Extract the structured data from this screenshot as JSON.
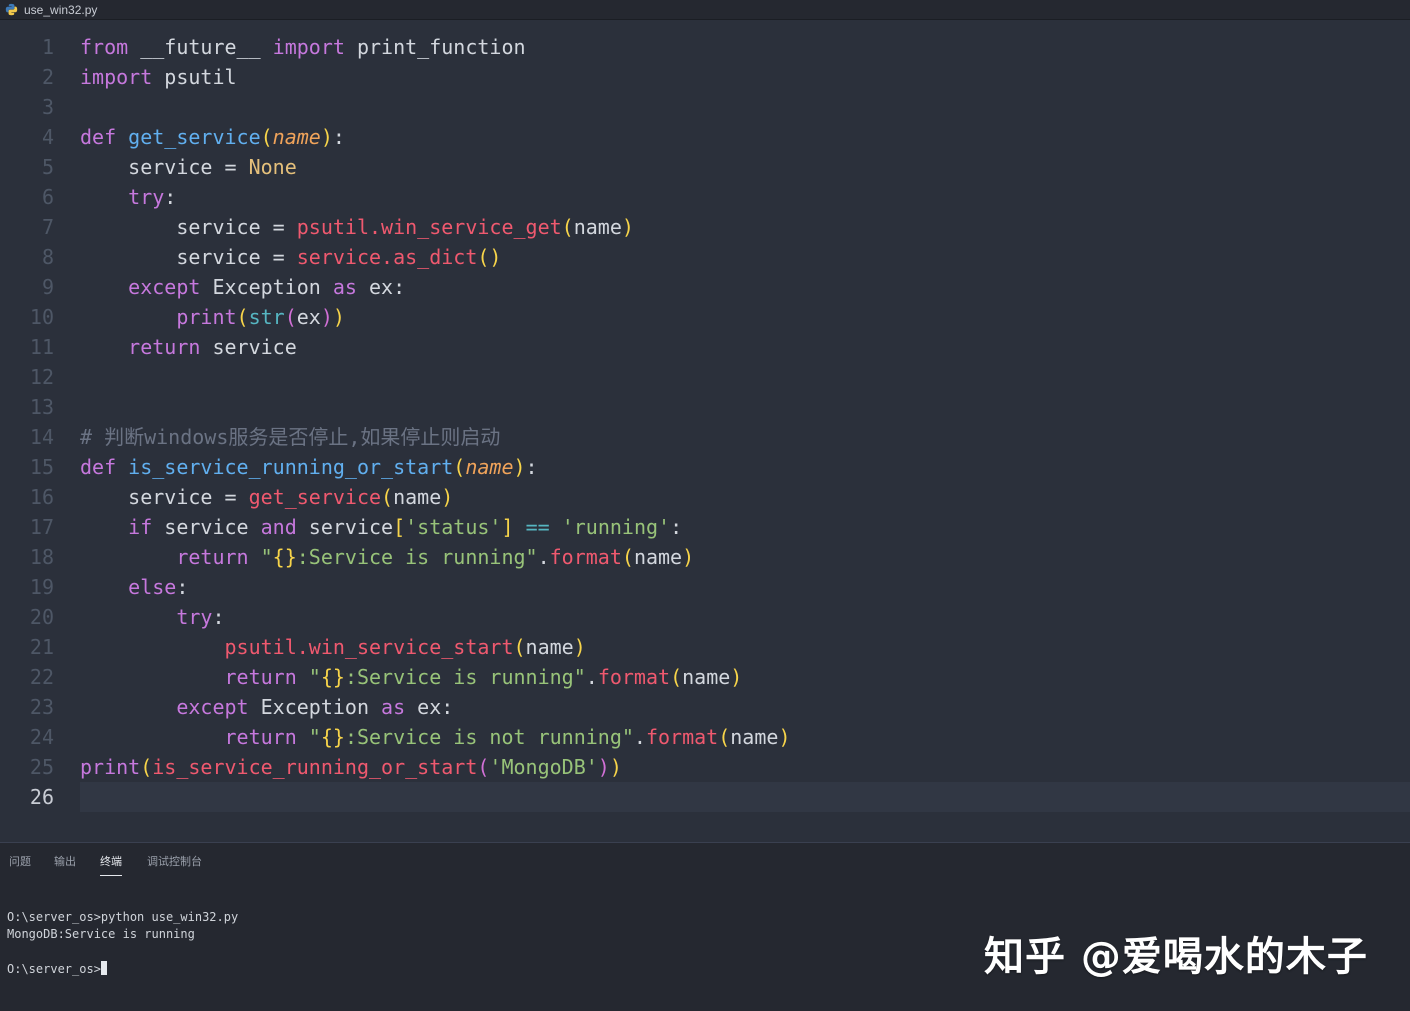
{
  "file_tab": {
    "name": "use_win32.py",
    "icon": "python-file-icon"
  },
  "editor": {
    "active_line": 26,
    "lines": [
      {
        "n": "1",
        "tokens": [
          [
            "kw",
            "from"
          ],
          [
            "plain",
            " __future__ "
          ],
          [
            "kw",
            "import"
          ],
          [
            "plain",
            " print_function"
          ]
        ]
      },
      {
        "n": "2",
        "tokens": [
          [
            "kw",
            "import"
          ],
          [
            "plain",
            " psutil"
          ]
        ]
      },
      {
        "n": "3",
        "tokens": []
      },
      {
        "n": "4",
        "tokens": [
          [
            "kw",
            "def"
          ],
          [
            "plain",
            " "
          ],
          [
            "fn",
            "get_service"
          ],
          [
            "p1",
            "("
          ],
          [
            "param",
            "name"
          ],
          [
            "p1",
            ")"
          ],
          [
            "plain",
            ":"
          ]
        ]
      },
      {
        "n": "5",
        "tokens": [
          [
            "plain",
            "    service = "
          ],
          [
            "const",
            "None"
          ]
        ]
      },
      {
        "n": "6",
        "tokens": [
          [
            "plain",
            "    "
          ],
          [
            "kw",
            "try"
          ],
          [
            "plain",
            ":"
          ]
        ]
      },
      {
        "n": "7",
        "tokens": [
          [
            "plain",
            "        service = "
          ],
          [
            "call",
            "psutil.win_service_get"
          ],
          [
            "p1",
            "("
          ],
          [
            "pn",
            "name"
          ],
          [
            "p1",
            ")"
          ]
        ]
      },
      {
        "n": "8",
        "tokens": [
          [
            "plain",
            "        service = "
          ],
          [
            "call",
            "service.as_dict"
          ],
          [
            "p1",
            "()"
          ]
        ]
      },
      {
        "n": "9",
        "tokens": [
          [
            "plain",
            "    "
          ],
          [
            "kw",
            "except"
          ],
          [
            "plain",
            " Exception "
          ],
          [
            "kw",
            "as"
          ],
          [
            "plain",
            " ex:"
          ]
        ]
      },
      {
        "n": "10",
        "tokens": [
          [
            "plain",
            "        "
          ],
          [
            "bi",
            "print"
          ],
          [
            "p1",
            "("
          ],
          [
            "type",
            "str"
          ],
          [
            "p2",
            "("
          ],
          [
            "pn",
            "ex"
          ],
          [
            "p2",
            ")"
          ],
          [
            "p1",
            ")"
          ]
        ]
      },
      {
        "n": "11",
        "tokens": [
          [
            "plain",
            "    "
          ],
          [
            "kw",
            "return"
          ],
          [
            "plain",
            " service"
          ]
        ]
      },
      {
        "n": "12",
        "tokens": []
      },
      {
        "n": "13",
        "tokens": []
      },
      {
        "n": "14",
        "tokens": [
          [
            "cmt",
            "# 判断windows服务是否停止,如果停止则启动"
          ]
        ]
      },
      {
        "n": "15",
        "tokens": [
          [
            "kw",
            "def"
          ],
          [
            "plain",
            " "
          ],
          [
            "fn",
            "is_service_running_or_start"
          ],
          [
            "p1",
            "("
          ],
          [
            "param",
            "name"
          ],
          [
            "p1",
            ")"
          ],
          [
            "plain",
            ":"
          ]
        ]
      },
      {
        "n": "16",
        "tokens": [
          [
            "plain",
            "    service = "
          ],
          [
            "call",
            "get_service"
          ],
          [
            "p1",
            "("
          ],
          [
            "pn",
            "name"
          ],
          [
            "p1",
            ")"
          ]
        ]
      },
      {
        "n": "17",
        "tokens": [
          [
            "plain",
            "    "
          ],
          [
            "kw",
            "if"
          ],
          [
            "plain",
            " service "
          ],
          [
            "kw",
            "and"
          ],
          [
            "plain",
            " service"
          ],
          [
            "p1",
            "["
          ],
          [
            "str",
            "'status'"
          ],
          [
            "p1",
            "]"
          ],
          [
            "plain",
            " "
          ],
          [
            "op",
            "=="
          ],
          [
            "plain",
            " "
          ],
          [
            "str",
            "'running'"
          ],
          [
            "plain",
            ":"
          ]
        ]
      },
      {
        "n": "18",
        "tokens": [
          [
            "plain",
            "        "
          ],
          [
            "kw",
            "return"
          ],
          [
            "plain",
            " "
          ],
          [
            "str",
            "\""
          ],
          [
            "p1",
            "{}"
          ],
          [
            "str",
            ":Service is running\""
          ],
          [
            "plain",
            "."
          ],
          [
            "call",
            "format"
          ],
          [
            "p1",
            "("
          ],
          [
            "pn",
            "name"
          ],
          [
            "p1",
            ")"
          ]
        ]
      },
      {
        "n": "19",
        "tokens": [
          [
            "plain",
            "    "
          ],
          [
            "kw",
            "else"
          ],
          [
            "plain",
            ":"
          ]
        ]
      },
      {
        "n": "20",
        "tokens": [
          [
            "plain",
            "        "
          ],
          [
            "kw",
            "try"
          ],
          [
            "plain",
            ":"
          ]
        ]
      },
      {
        "n": "21",
        "tokens": [
          [
            "plain",
            "            "
          ],
          [
            "call",
            "psutil.win_service_start"
          ],
          [
            "p1",
            "("
          ],
          [
            "pn",
            "name"
          ],
          [
            "p1",
            ")"
          ]
        ]
      },
      {
        "n": "22",
        "tokens": [
          [
            "plain",
            "            "
          ],
          [
            "kw",
            "return"
          ],
          [
            "plain",
            " "
          ],
          [
            "str",
            "\""
          ],
          [
            "p1",
            "{}"
          ],
          [
            "str",
            ":Service is running\""
          ],
          [
            "plain",
            "."
          ],
          [
            "call",
            "format"
          ],
          [
            "p1",
            "("
          ],
          [
            "pn",
            "name"
          ],
          [
            "p1",
            ")"
          ]
        ]
      },
      {
        "n": "23",
        "tokens": [
          [
            "plain",
            "        "
          ],
          [
            "kw",
            "except"
          ],
          [
            "plain",
            " Exception "
          ],
          [
            "kw",
            "as"
          ],
          [
            "plain",
            " ex:"
          ]
        ]
      },
      {
        "n": "24",
        "tokens": [
          [
            "plain",
            "            "
          ],
          [
            "kw",
            "return"
          ],
          [
            "plain",
            " "
          ],
          [
            "str",
            "\""
          ],
          [
            "p1",
            "{}"
          ],
          [
            "str",
            ":Service is not running\""
          ],
          [
            "plain",
            "."
          ],
          [
            "call",
            "format"
          ],
          [
            "p1",
            "("
          ],
          [
            "pn",
            "name"
          ],
          [
            "p1",
            ")"
          ]
        ]
      },
      {
        "n": "25",
        "tokens": [
          [
            "bi",
            "print"
          ],
          [
            "p1",
            "("
          ],
          [
            "call",
            "is_service_running_or_start"
          ],
          [
            "p2",
            "("
          ],
          [
            "str",
            "'MongoDB'"
          ],
          [
            "p2",
            ")"
          ],
          [
            "p1",
            ")"
          ]
        ]
      },
      {
        "n": "26",
        "tokens": []
      }
    ]
  },
  "panel": {
    "tabs": [
      {
        "label": "问题",
        "active": false
      },
      {
        "label": "输出",
        "active": false
      },
      {
        "label": "终端",
        "active": true
      },
      {
        "label": "调试控制台",
        "active": false
      }
    ],
    "terminal": {
      "command_line": "O:\\server_os>python use_win32.py",
      "output_line": "MongoDB:Service is running",
      "prompt": "O:\\server_os>"
    }
  },
  "watermark": "知乎 @爱喝水的木子"
}
